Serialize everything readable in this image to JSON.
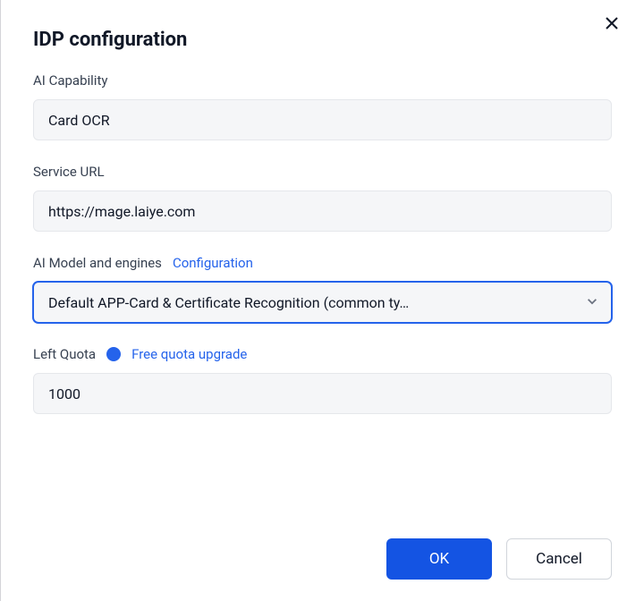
{
  "dialog": {
    "title": "IDP configuration",
    "ai_capability_label": "AI Capability",
    "ai_capability_value": "Card OCR",
    "service_url_label": "Service URL",
    "service_url_value": "https://mage.laiye.com",
    "model_label": "AI Model and engines",
    "model_config_link": "Configuration",
    "model_value": "Default APP-Card & Certificate Recognition (common ty…",
    "left_quota_label": "Left Quota",
    "quota_upgrade_link": "Free quota upgrade",
    "left_quota_value": "1000",
    "ok_label": "OK",
    "cancel_label": "Cancel"
  }
}
